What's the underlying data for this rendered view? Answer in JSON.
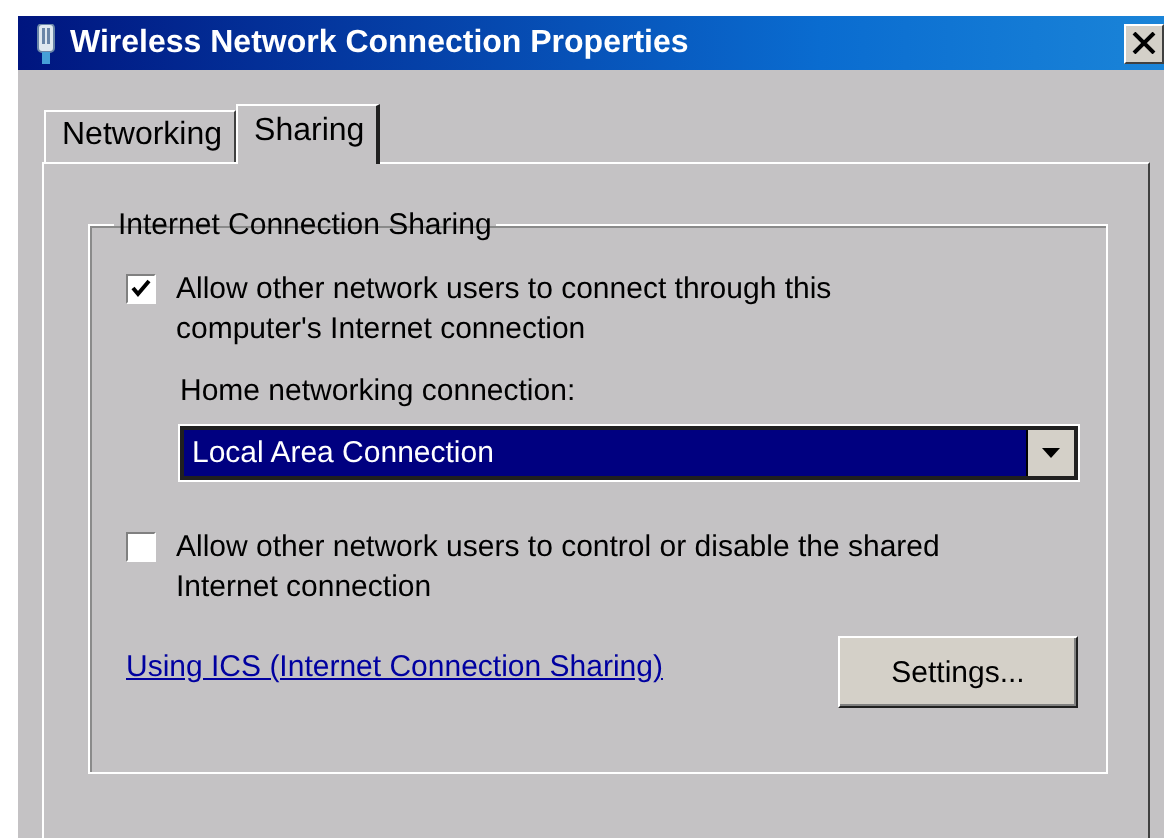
{
  "window": {
    "title": "Wireless Network Connection Properties"
  },
  "tabs": [
    {
      "label": "Networking",
      "selected": false
    },
    {
      "label": "Sharing",
      "selected": true
    }
  ],
  "group": {
    "title": "Internet Connection Sharing",
    "options": [
      {
        "kind": "checkbox",
        "label": "Allow other network users to connect through this computer's Internet connection",
        "checked": true
      },
      {
        "kind": "dropdown",
        "label": "Home networking connection:",
        "value": "Local Area Connection"
      },
      {
        "kind": "checkbox",
        "label": "Allow other network users to control or disable the shared Internet connection",
        "checked": false
      }
    ],
    "link": "Using ICS (Internet Connection Sharing)",
    "button": "Settings..."
  }
}
